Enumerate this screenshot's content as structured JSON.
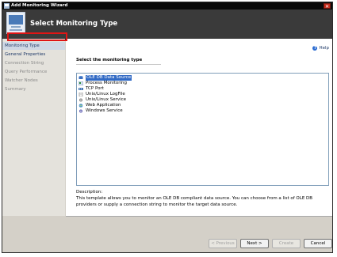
{
  "window": {
    "title": "Add Monitoring Wizard",
    "close_glyph": "✕"
  },
  "header": {
    "title": "Select Monitoring Type"
  },
  "sidebar": {
    "items": [
      {
        "label": "Monitoring Type",
        "state": "active"
      },
      {
        "label": "General Properties",
        "state": "normal"
      },
      {
        "label": "Connection String",
        "state": "disabled"
      },
      {
        "label": "Query Performance",
        "state": "disabled"
      },
      {
        "label": "Watcher Nodes",
        "state": "disabled"
      },
      {
        "label": "Summary",
        "state": "disabled"
      }
    ]
  },
  "main": {
    "help_label": "Help",
    "help_glyph": "?",
    "section_label": "Select the monitoring type",
    "list": [
      {
        "label": "OLE DB Data Source",
        "icon": "database-icon",
        "selected": true
      },
      {
        "label": "Process Monitoring",
        "icon": "process-icon",
        "selected": false
      },
      {
        "label": "TCP Port",
        "icon": "network-port-icon",
        "selected": false
      },
      {
        "label": "Unix/Linux LogFile",
        "icon": "logfile-icon",
        "selected": false
      },
      {
        "label": "Unix/Linux Service",
        "icon": "service-icon",
        "selected": false
      },
      {
        "label": "Web Application",
        "icon": "web-application-icon",
        "selected": false
      },
      {
        "label": "Windows Service",
        "icon": "windows-service-icon",
        "selected": false
      }
    ],
    "description_label": "Description:",
    "description_text": "This template allows you to monitor an OLE DB compliant data source. You can choose from a list of OLE DB providers or supply a connection string to monitor the target data source."
  },
  "footer": {
    "previous_label": "< Previous",
    "next_label": "Next >",
    "create_label": "Create",
    "cancel_label": "Cancel"
  },
  "colors": {
    "selection": "#316ac5",
    "highlight_box": "#e01515",
    "header_bg": "#3a3a3a"
  }
}
